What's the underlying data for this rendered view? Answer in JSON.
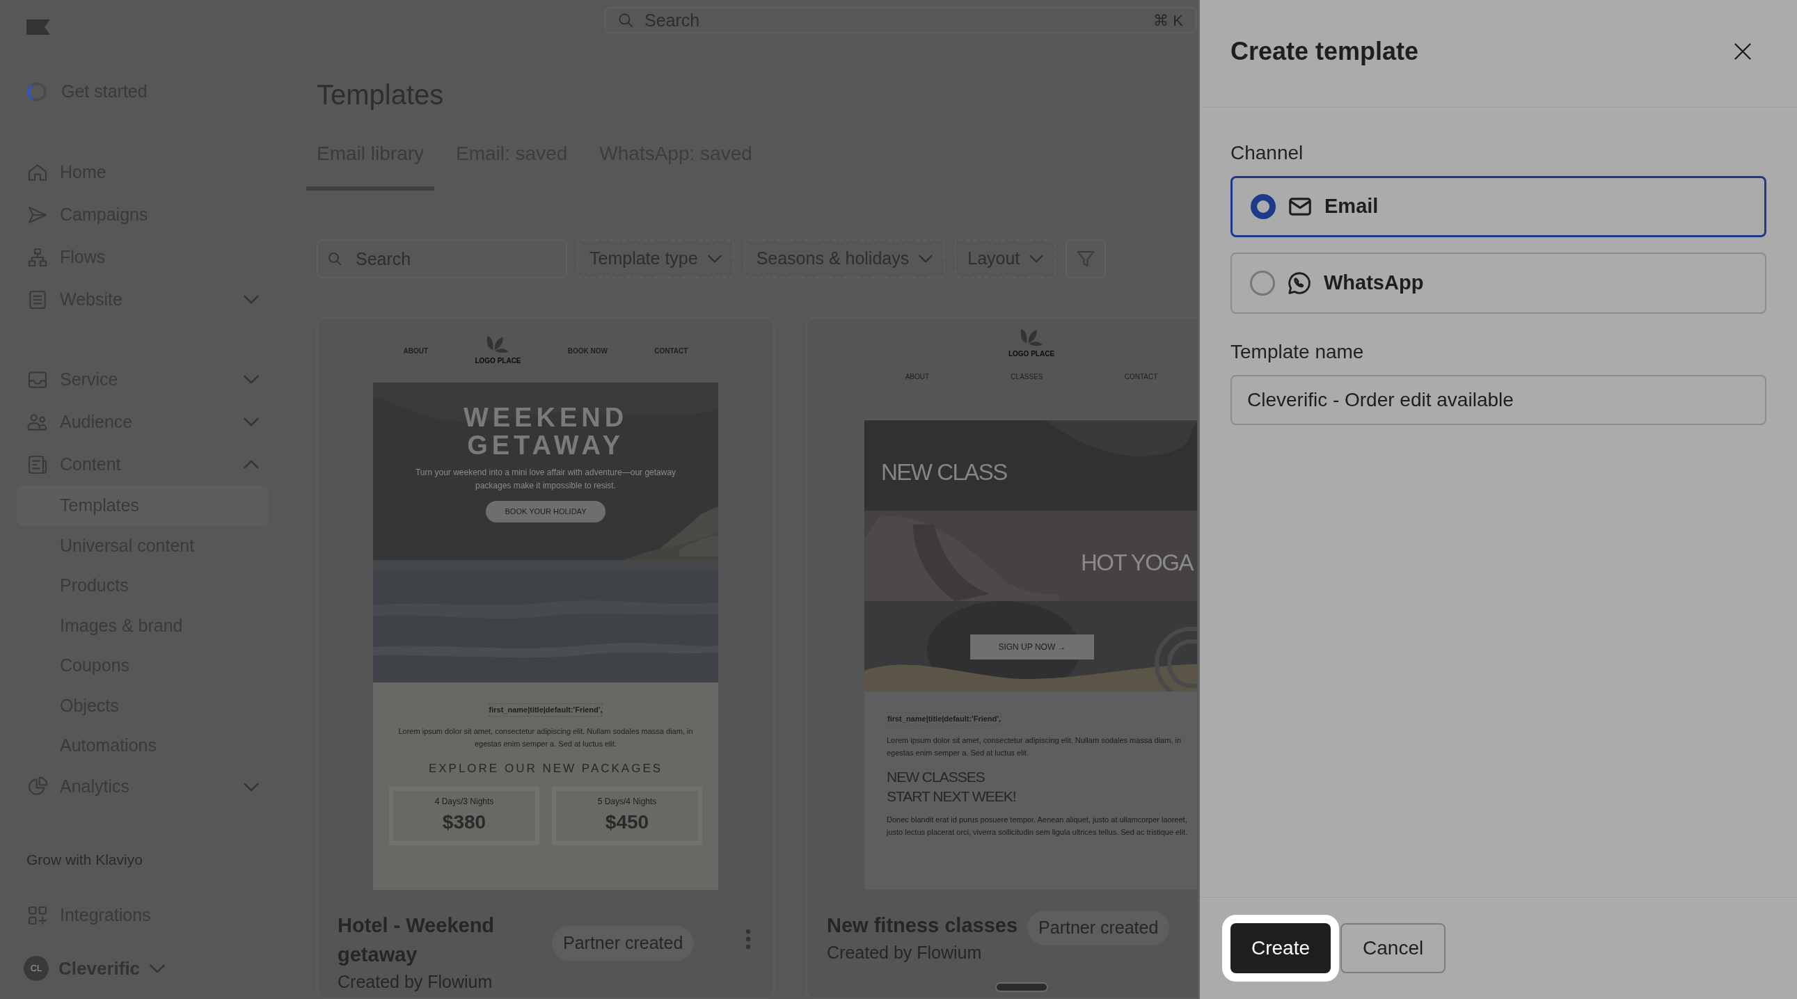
{
  "sidebar": {
    "get_started": {
      "label": "Get started",
      "level": 0.3
    },
    "items": [
      {
        "label": "Home",
        "kind": "link"
      },
      {
        "label": "Campaigns",
        "kind": "link"
      },
      {
        "label": "Flows",
        "kind": "link"
      },
      {
        "label": "Website",
        "kind": "group",
        "expanded": false
      },
      {
        "label": "Service",
        "kind": "group",
        "expanded": false
      },
      {
        "label": "Audience",
        "kind": "group",
        "expanded": false
      },
      {
        "label": "Content",
        "kind": "group",
        "expanded": true,
        "children": [
          {
            "label": "Templates",
            "selected": true
          },
          {
            "label": "Universal content",
            "selected": false
          },
          {
            "label": "Products",
            "selected": false
          },
          {
            "label": "Images & brand",
            "selected": false
          },
          {
            "label": "Coupons",
            "selected": false
          },
          {
            "label": "Objects",
            "selected": false
          },
          {
            "label": "Automations",
            "selected": false
          }
        ]
      },
      {
        "label": "Analytics",
        "kind": "group",
        "expanded": false
      }
    ],
    "section_title": "Grow with Klaviyo",
    "bottom_items": [
      {
        "label": "Integrations"
      }
    ],
    "account": {
      "initials": "CL",
      "name": "Cleverific"
    }
  },
  "top_search": {
    "placeholder": "Search",
    "shortcut": "⌘ K"
  },
  "page": {
    "title": "Templates",
    "tabs": [
      {
        "label": "Email library",
        "selected": true
      },
      {
        "label": "Email: saved",
        "selected": false
      },
      {
        "label": "WhatsApp: saved",
        "selected": false
      }
    ],
    "search": {
      "placeholder": "Search"
    },
    "filters": [
      {
        "label": "Template type"
      },
      {
        "label": "Seasons & holidays"
      },
      {
        "label": "Layout"
      }
    ],
    "cards": [
      {
        "title": "Hotel - Weekend getaway",
        "badge": "Partner created",
        "author": "Created by Flowium",
        "has_menu": true,
        "preview": {
          "kind": "getaway",
          "nav": [
            "ABOUT",
            "BOOK NOW",
            "CONTACT"
          ],
          "logo_text": "LOGO PLACE",
          "headline": [
            "WEEKEND",
            "GETAWAY"
          ],
          "intro": "Turn your weekend into a mini love affair with adventure—our getaway packages make it impossible to resist.",
          "cta": "BOOK YOUR HOLIDAY",
          "greeting": "first_name|title|default:'Friend',",
          "body": "Lorem ipsum dolor sit amet, consectetur adipiscing elit. Nullam sodales massa diam, in egestas enim semper a. Sed at luctus elit.",
          "section_title": "EXPLORE OUR NEW PACKAGES",
          "packages": [
            {
              "name": "4 Days/3 Nights",
              "price": "$380"
            },
            {
              "name": "5 Days/4 Nights",
              "price": "$450"
            }
          ]
        }
      },
      {
        "title": "New fitness classes",
        "badge": "Partner created",
        "author": "Created by Flowium",
        "has_menu": false,
        "preview": {
          "kind": "classes",
          "logo_text": "LOGO PLACE",
          "nav": [
            "ABOUT",
            "CLASSES",
            "CONTACT"
          ],
          "banners": [
            "NEW CLASS",
            "HOT YOGA"
          ],
          "cta": "SIGN UP NOW →",
          "greeting": "first_name|title|default:'Friend',",
          "body": "Lorem ipsum dolor sit amet, consectetur adipiscing elit. Nullam sodales massa diam, in egestas enim semper a. Sed at luctus elit.",
          "section_title": [
            "NEW CLASSES",
            "START NEXT WEEK!"
          ],
          "body_2": "Donec blandit erat id purus posuere tempor. Aenean aliquet, justo at ullamcorper laoreet, justo lectus placerat orci, viverra sollicitudin sem ligula ultrices tellus. Sed ac tristique elit."
        }
      }
    ]
  },
  "panel": {
    "title": "Create template",
    "channel_label": "Channel",
    "channels": [
      {
        "label": "Email",
        "selected": true
      },
      {
        "label": "WhatsApp",
        "selected": false
      }
    ],
    "name_label": "Template name",
    "name_value": "Cleverific - Order edit available",
    "buttons": [
      {
        "label": "Create",
        "kind": "primary"
      },
      {
        "label": "Cancel",
        "kind": "secondary"
      }
    ]
  }
}
